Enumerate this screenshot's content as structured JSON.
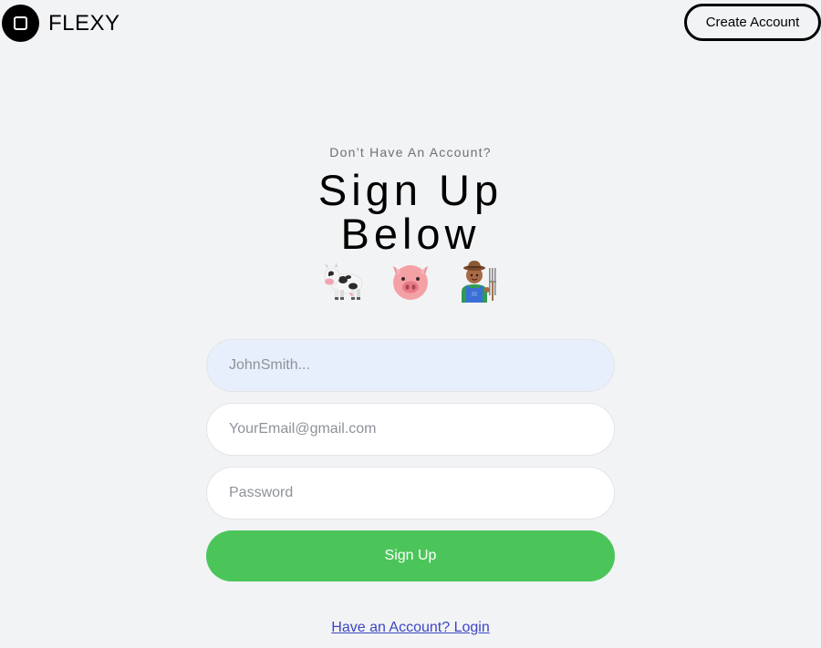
{
  "header": {
    "brand": "FLEXY",
    "create_account_label": "Create Account"
  },
  "hero": {
    "subtitle": "Don’t Have An Account?",
    "title_line1": "Sign Up",
    "title_line2": "Below",
    "emojis": [
      "cow-icon",
      "pig-icon",
      "farmer-icon"
    ]
  },
  "form": {
    "name_placeholder": "JohnSmith...",
    "email_placeholder": "YourEmail@gmail.com",
    "password_placeholder": "Password",
    "submit_label": "Sign Up",
    "login_link": "Have an Account? Login"
  },
  "colors": {
    "background": "#f2f3f5",
    "button_green": "#4bc559",
    "link_blue": "#3b46c4",
    "autofill_blue": "#e8effc"
  }
}
